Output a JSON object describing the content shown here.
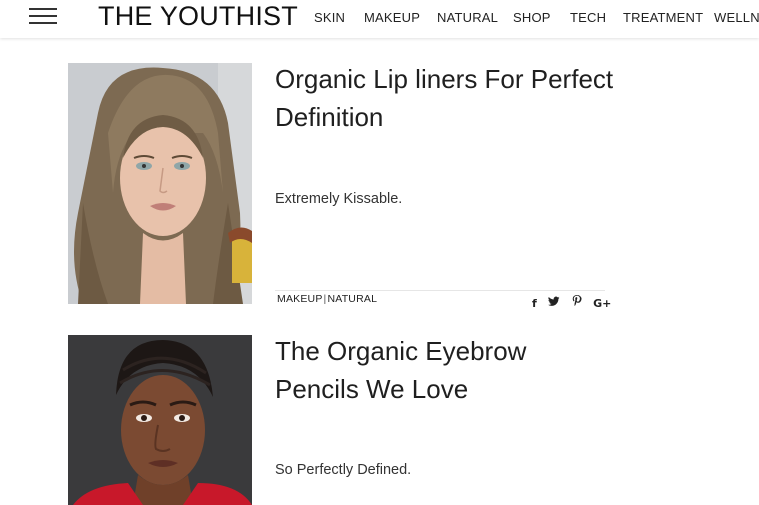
{
  "site": {
    "logo": "THE YOUTHIST",
    "menu_icon": "hamburger-menu-icon"
  },
  "nav": [
    {
      "label": "SKIN"
    },
    {
      "label": "MAKEUP"
    },
    {
      "label": "NATURAL"
    },
    {
      "label": "SHOP"
    },
    {
      "label": "TECH"
    },
    {
      "label": "TREATMENT"
    },
    {
      "label": "WELLNE"
    }
  ],
  "articles": [
    {
      "title": "Organic Lip liners For Perfect Definition",
      "excerpt": "Extremely Kissable.",
      "category_1": "MAKEUP",
      "category_2": "NATURAL",
      "separator": "|"
    },
    {
      "title": "The Organic Eyebrow Pencils We Love",
      "excerpt": "So Perfectly Defined."
    }
  ],
  "share_icons": {
    "facebook": "f",
    "twitter": "twitter-icon",
    "pinterest": "pinterest-icon",
    "google_plus": "G+"
  }
}
